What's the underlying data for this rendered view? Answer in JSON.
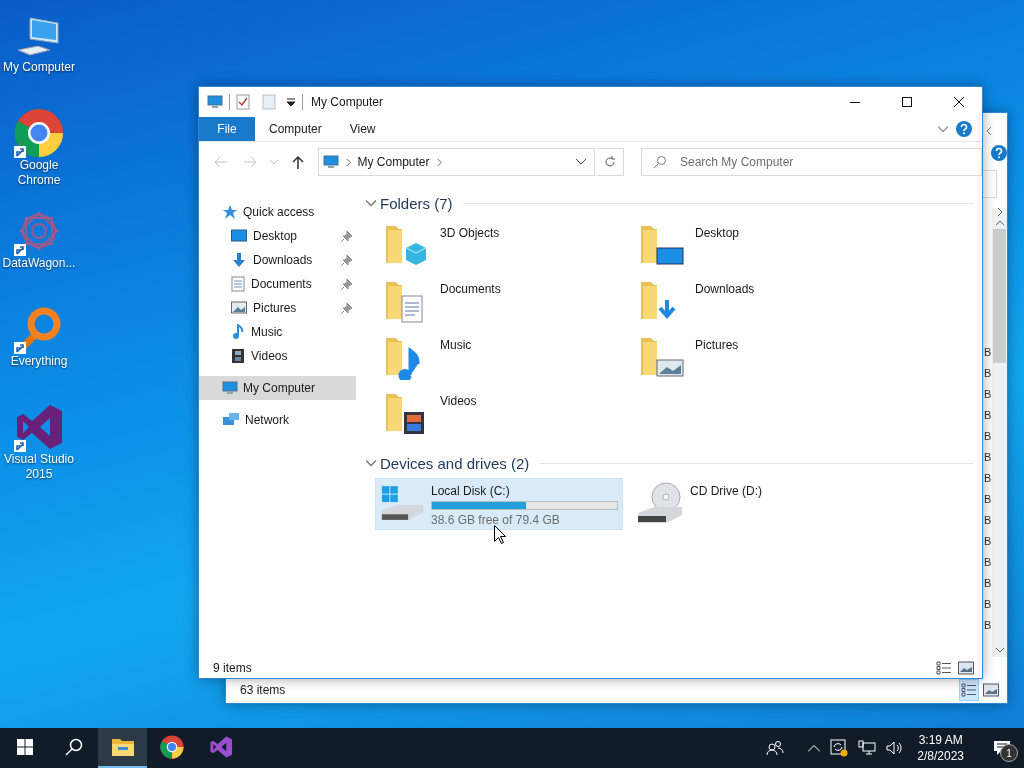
{
  "desktop_icons": [
    {
      "kind": "computer",
      "label": "My Computer",
      "shortcut": false
    },
    {
      "kind": "chrome",
      "label": "Google Chrome",
      "shortcut": true
    },
    {
      "kind": "datawagon",
      "label": "DataWagon...",
      "shortcut": true
    },
    {
      "kind": "everything",
      "label": "Everything",
      "shortcut": true
    },
    {
      "kind": "visual-studio",
      "label": "Visual Studio 2015",
      "shortcut": true
    }
  ],
  "back_window": {
    "column_fragments": [
      "B",
      "B",
      "B",
      "B",
      "B",
      "B",
      "B",
      "B",
      "B",
      "B",
      "B",
      "B",
      "B",
      "B"
    ],
    "status_bar": {
      "text": "63 items",
      "views": [
        {
          "kind": "details",
          "selected": true
        },
        {
          "kind": "large-icons",
          "selected": false
        }
      ]
    }
  },
  "window": {
    "title": "My Computer",
    "ribbon_tabs": [
      {
        "label": "File",
        "kind": "file"
      },
      {
        "label": "Computer",
        "kind": "tab"
      },
      {
        "label": "View",
        "kind": "tab"
      }
    ],
    "nav_buttons": [
      {
        "kind": "back",
        "disabled": true
      },
      {
        "kind": "forward",
        "disabled": true
      },
      {
        "kind": "recent",
        "disabled": true
      },
      {
        "kind": "up",
        "disabled": false
      }
    ],
    "address": {
      "path": [
        "My Computer"
      ]
    },
    "search": {
      "placeholder": "Search My Computer"
    },
    "nav_pane": [
      {
        "kind": "star",
        "label": "Quick access",
        "selected": false,
        "children": [
          {
            "kind": "desktop",
            "label": "Desktop",
            "pinned": true,
            "selected": false
          },
          {
            "kind": "downloads",
            "label": "Downloads",
            "pinned": true,
            "selected": false
          },
          {
            "kind": "documents",
            "label": "Documents",
            "pinned": true,
            "selected": false
          },
          {
            "kind": "pictures",
            "label": "Pictures",
            "pinned": true,
            "selected": false
          },
          {
            "kind": "music",
            "label": "Music",
            "pinned": false,
            "selected": false
          },
          {
            "kind": "videos",
            "label": "Videos",
            "pinned": false,
            "selected": false
          }
        ]
      },
      {
        "kind": "computer",
        "label": "My Computer",
        "selected": true
      },
      {
        "kind": "network",
        "label": "Network",
        "selected": false
      }
    ],
    "groups": [
      {
        "kind": "folders",
        "title": "Folders (7)",
        "expanded": true,
        "items": [
          {
            "kind": "cube",
            "label": "3D Objects"
          },
          {
            "kind": "desktop",
            "label": "Desktop"
          },
          {
            "kind": "documents",
            "label": "Documents"
          },
          {
            "kind": "downloads",
            "label": "Downloads"
          },
          {
            "kind": "music",
            "label": "Music"
          },
          {
            "kind": "pictures",
            "label": "Pictures"
          },
          {
            "kind": "videos",
            "label": "Videos"
          }
        ]
      },
      {
        "kind": "drives",
        "title": "Devices and drives (2)",
        "expanded": true,
        "items": [
          {
            "kind": "hdd",
            "label": "Local Disk (C:)",
            "level": 0.51,
            "free": "38.6 GB free of 79.4 GB",
            "selected": true
          },
          {
            "kind": "cd",
            "label": "CD Drive (D:)",
            "selected": false
          }
        ]
      }
    ],
    "status_bar": {
      "text": "9 items",
      "views": [
        {
          "kind": "details",
          "selected": false
        },
        {
          "kind": "large-icons",
          "selected": false
        }
      ]
    }
  },
  "taskbar": {
    "items": [
      {
        "kind": "start",
        "selected": false
      },
      {
        "kind": "search",
        "selected": false
      },
      {
        "kind": "explorer",
        "selected": true
      },
      {
        "kind": "chrome",
        "selected": false
      },
      {
        "kind": "visual-studio",
        "selected": false
      }
    ],
    "time": "3:19 AM",
    "date": "2/8/2023",
    "notification_count": "1"
  }
}
